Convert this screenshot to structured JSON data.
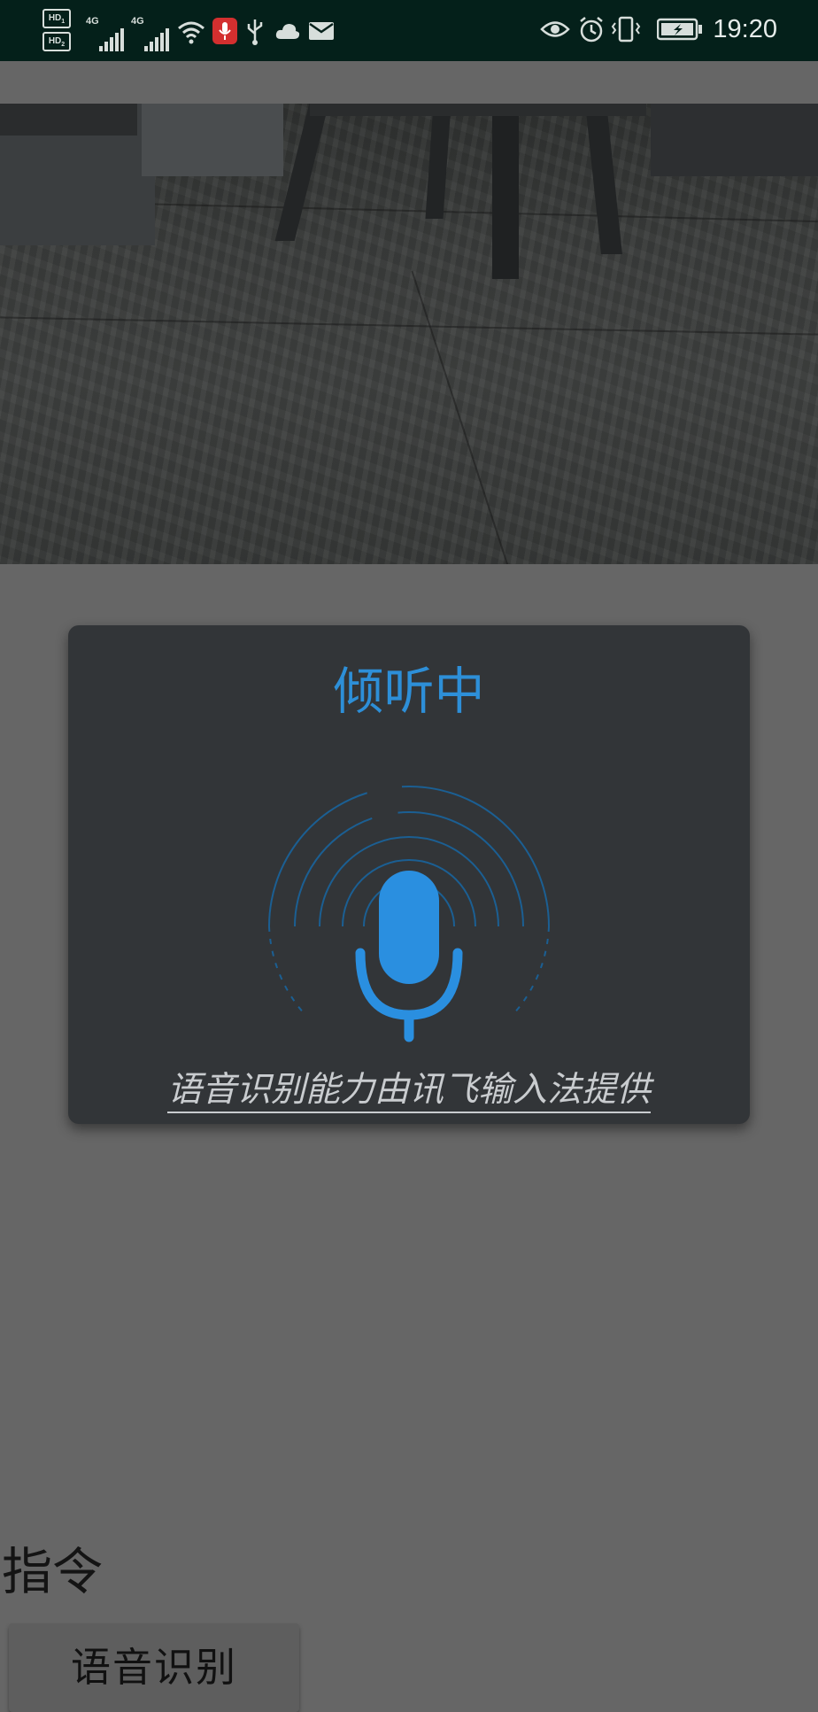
{
  "status_bar": {
    "time": "19:20",
    "sim1_badge": "HD",
    "sim1_sub": "1",
    "sim2_badge": "HD",
    "sim2_sub": "2",
    "network1": "4G",
    "network2": "4G",
    "left_icons": [
      "signal-icon",
      "signal-icon",
      "wifi-icon",
      "microphone-recording-icon",
      "usb-icon",
      "cloud-icon",
      "mail-icon"
    ],
    "right_icons": [
      "eye-icon",
      "alarm-icon",
      "vibrate-icon",
      "battery-charging-icon"
    ]
  },
  "dialog": {
    "title": "倾听中",
    "credit_link": "语音识别能力由讯飞输入法提供",
    "accent_color": "#2d8fd8",
    "icon": "microphone-icon"
  },
  "main": {
    "command_label": "指令",
    "speech_button_label": "语音识别"
  }
}
